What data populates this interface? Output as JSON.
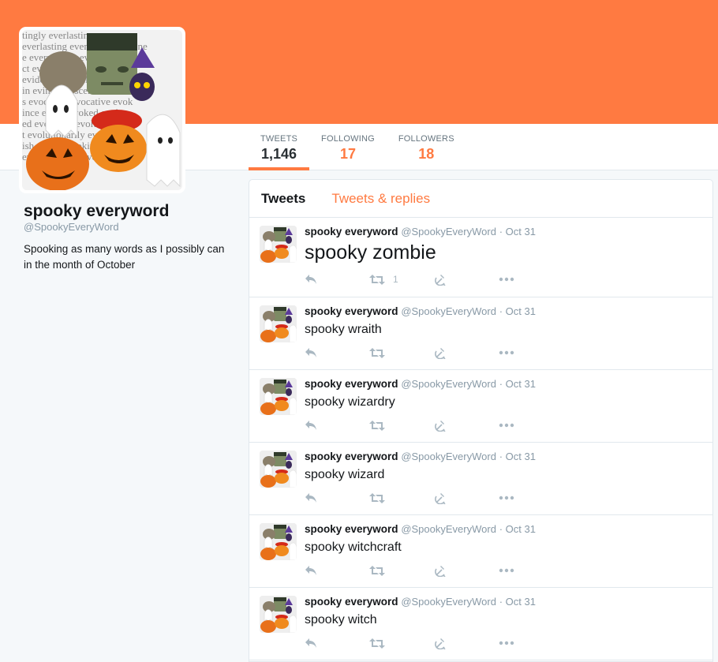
{
  "colors": {
    "accent": "#ff7a41",
    "banner": "#ff7a41",
    "icon": "#aab8c2"
  },
  "profile": {
    "name": "spooky everyword",
    "handle": "@SpookyEveryWord",
    "bio": "Spooking as many words as I possibly can in the month of October",
    "avatar_words": [
      "tingly everlasting evermore",
      "everlasting everyday everyone",
      "e everywhere everybody ever",
      "ct evict evidence evident ev",
      "evident evil evildoer evile",
      "in evince evisceral evit",
      "s evocation evocative evok",
      "ince evoke evoked evoke",
      "ed evolution evolutio",
      "t evolutionarily evol",
      "ish evoker evoking evokes",
      "evolutionarily evol follow"
    ]
  },
  "stats": [
    {
      "label": "TWEETS",
      "value": "1,146"
    },
    {
      "label": "FOLLOWING",
      "value": "17"
    },
    {
      "label": "FOLLOWERS",
      "value": "18"
    }
  ],
  "timeline_tabs": [
    "Tweets",
    "Tweets & replies"
  ],
  "tweets": [
    {
      "name": "spooky everyword",
      "handle": "@SpookyEveryWord",
      "date": "· Oct 31",
      "text": "spooky zombie",
      "retweets": "1"
    },
    {
      "name": "spooky everyword",
      "handle": "@SpookyEveryWord",
      "date": "· Oct 31",
      "text": "spooky wraith",
      "retweets": ""
    },
    {
      "name": "spooky everyword",
      "handle": "@SpookyEveryWord",
      "date": "· Oct 31",
      "text": "spooky wizardry",
      "retweets": ""
    },
    {
      "name": "spooky everyword",
      "handle": "@SpookyEveryWord",
      "date": "· Oct 31",
      "text": "spooky wizard",
      "retweets": ""
    },
    {
      "name": "spooky everyword",
      "handle": "@SpookyEveryWord",
      "date": "· Oct 31",
      "text": "spooky witchcraft",
      "retweets": ""
    },
    {
      "name": "spooky everyword",
      "handle": "@SpookyEveryWord",
      "date": "· Oct 31",
      "text": "spooky witch",
      "retweets": ""
    }
  ],
  "icons": {
    "reply": "reply-icon",
    "retweet": "retweet-icon",
    "favorite": "hammer-sickle-icon",
    "more": "more-icon"
  }
}
